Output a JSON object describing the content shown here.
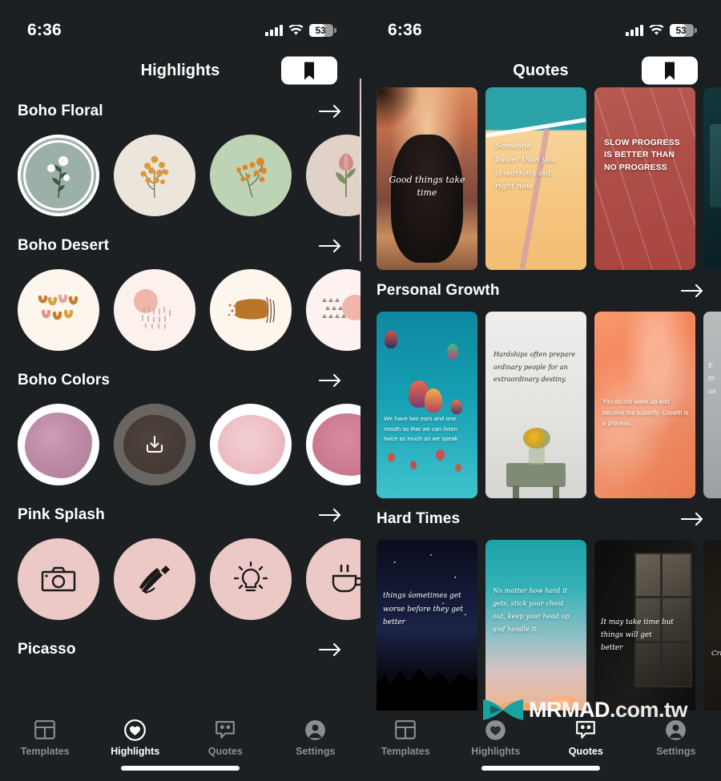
{
  "left_phone": {
    "status": {
      "time": "6:36",
      "battery_level": "53",
      "signal_icon": "cellular-bars-icon",
      "wifi_icon": "wifi-icon",
      "battery_icon": "battery-icon"
    },
    "nav": {
      "title": "Highlights",
      "bookmark_icon": "bookmark-icon"
    },
    "sections": [
      {
        "title": "Boho Floral",
        "arrow_icon": "arrow-right-icon",
        "items": [
          {
            "name": "sage-flower-highlight",
            "bg": "#9db0a8",
            "selected": true,
            "art": "flower-white"
          },
          {
            "name": "cream-flower-highlight",
            "bg": "#ece5dc",
            "selected": false,
            "art": "flower-orange"
          },
          {
            "name": "green-flower-highlight",
            "bg": "#bdd3b4",
            "selected": false,
            "art": "flower-orange"
          },
          {
            "name": "beige-tulip-highlight",
            "bg": "#e0d2c8",
            "selected": false,
            "art": "tulip-pink"
          }
        ]
      },
      {
        "title": "Boho Desert",
        "arrow_icon": "arrow-right-icon",
        "items": [
          {
            "name": "squiggle-highlight",
            "bg": "#fdf6ec",
            "selected": false,
            "art": "squiggles"
          },
          {
            "name": "sun-rain-highlight",
            "bg": "#fdf1ee",
            "selected": false,
            "art": "sun-dashes"
          },
          {
            "name": "brush-stroke-highlight",
            "bg": "#fdf6ec",
            "selected": false,
            "art": "brush"
          },
          {
            "name": "dots-circle-highlight",
            "bg": "#fdf2ef",
            "selected": false,
            "art": "dots"
          }
        ]
      },
      {
        "title": "Boho Colors",
        "arrow_icon": "arrow-right-icon",
        "items": [
          {
            "name": "mauve-watercolor-highlight",
            "bg": "#ffffff",
            "blob": "#c294ab",
            "selected": false,
            "art": "watercolor"
          },
          {
            "name": "brown-watercolor-highlight",
            "bg": "#b9b3ad",
            "blob": "#6b5548",
            "selected": false,
            "art": "watercolor",
            "download": true
          },
          {
            "name": "pink-watercolor-highlight",
            "bg": "#ffffff",
            "blob": "#efc2c6",
            "selected": false,
            "art": "watercolor"
          },
          {
            "name": "rose-watercolor-highlight",
            "bg": "#ffffff",
            "blob": "#cf8094",
            "selected": false,
            "art": "watercolor"
          }
        ]
      },
      {
        "title": "Pink Splash",
        "arrow_icon": "arrow-right-icon",
        "items": [
          {
            "name": "camera-highlight",
            "bg": "#ecc8c6",
            "selected": false,
            "art": "camera-icon"
          },
          {
            "name": "makeup-brush-highlight",
            "bg": "#ecc8c6",
            "selected": false,
            "art": "makeup-brush-icon"
          },
          {
            "name": "lightbulb-highlight",
            "bg": "#ecc8c6",
            "selected": false,
            "art": "lightbulb-icon"
          },
          {
            "name": "coffee-cup-highlight",
            "bg": "#ecc8c6",
            "selected": false,
            "art": "coffee-cup-icon"
          }
        ]
      },
      {
        "title": "Picasso",
        "arrow_icon": "arrow-right-icon",
        "items": []
      }
    ],
    "tabs": [
      {
        "label": "Templates",
        "icon": "templates-grid-icon",
        "active": false
      },
      {
        "label": "Highlights",
        "icon": "heart-circle-icon",
        "active": true
      },
      {
        "label": "Quotes",
        "icon": "quote-bubble-icon",
        "active": false
      },
      {
        "label": "Settings",
        "icon": "account-circle-icon",
        "active": false
      }
    ]
  },
  "right_phone": {
    "status": {
      "time": "6:36",
      "battery_level": "53",
      "signal_icon": "cellular-bars-icon",
      "wifi_icon": "wifi-icon",
      "battery_icon": "battery-icon"
    },
    "nav": {
      "title": "Quotes",
      "bookmark_icon": "bookmark-icon"
    },
    "top_row": [
      {
        "name": "quote-card-good-things",
        "text": "Good things take time",
        "style": "script",
        "bg": "sunset-meditation"
      },
      {
        "name": "quote-card-someone-busier",
        "text": "Someone busier than you is working out right now",
        "style": "handwriting",
        "bg": "tennis-court"
      },
      {
        "name": "quote-card-slow-progress",
        "text": "SLOW PROGRESS IS BETTER THAN NO PROGRESS",
        "style": "bold-caps",
        "bg": "running-track"
      },
      {
        "name": "quote-card-partial",
        "text": "",
        "style": "",
        "bg": "dark-teal"
      }
    ],
    "sections": [
      {
        "title": "Personal Growth",
        "arrow_icon": "arrow-right-icon",
        "cards": [
          {
            "name": "quote-card-two-ears",
            "text": "We have two ears and one mouth so that we can listen twice as much as we speak",
            "style": "plain",
            "bg": "hot-air-balloons"
          },
          {
            "name": "quote-card-hardships",
            "text": "Hardships often prepare ordinary people for an extraordinary destiny.",
            "style": "script",
            "bg": "flowers-on-stool"
          },
          {
            "name": "quote-card-butterfly",
            "text": "You do not wake up and become the butterfly. Growth is a process.",
            "style": "plain",
            "bg": "orange-marble"
          },
          {
            "name": "quote-card-partial",
            "text": "",
            "style": "",
            "bg": "grey-stone"
          }
        ]
      },
      {
        "title": "Hard Times",
        "arrow_icon": "arrow-right-icon",
        "cards": [
          {
            "name": "quote-card-things-sometimes",
            "text": "things sometimes get worse before they get better",
            "style": "handwriting",
            "bg": "starry-night-forest"
          },
          {
            "name": "quote-card-no-matter",
            "text": "No matter how hard it gets, stick your chest out, keep your head up and handle it.",
            "style": "handwriting",
            "bg": "sunset-clouds"
          },
          {
            "name": "quote-card-may-take-time",
            "text": "It may take time but things will get better",
            "style": "script",
            "bg": "dark-window"
          },
          {
            "name": "quote-card-partial",
            "text": "Cris",
            "style": "script",
            "bg": "dark-room"
          }
        ]
      }
    ],
    "tabs": [
      {
        "label": "Templates",
        "icon": "templates-grid-icon",
        "active": false
      },
      {
        "label": "Highlights",
        "icon": "heart-circle-icon",
        "active": false
      },
      {
        "label": "Quotes",
        "icon": "quote-bubble-icon",
        "active": true
      },
      {
        "label": "Settings",
        "icon": "account-circle-icon",
        "active": false
      }
    ]
  },
  "watermark": {
    "brand": "MRMAD",
    "suffix": ".com.tw",
    "logo_icon": "butterfly-logo-icon",
    "color": "#18a2a0"
  }
}
